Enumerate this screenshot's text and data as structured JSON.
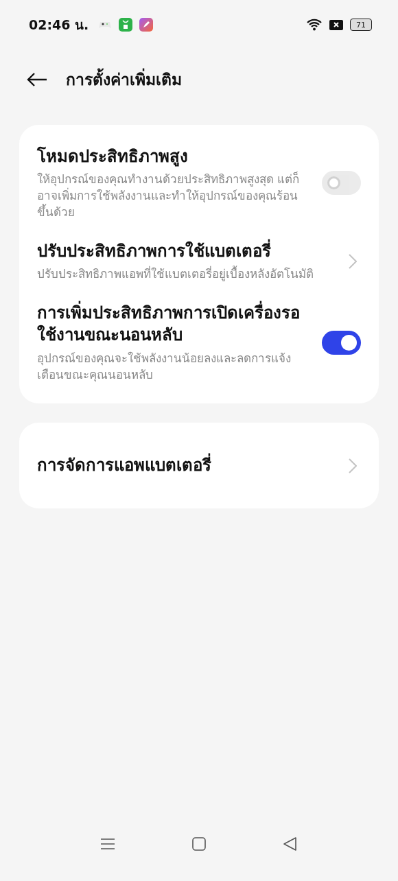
{
  "status_bar": {
    "time": "02:46 น.",
    "battery": "71"
  },
  "header": {
    "title": "การตั้งค่าเพิ่มเติม"
  },
  "groups": [
    {
      "items": [
        {
          "kind": "toggle",
          "title": "โหมดประสิทธิภาพสูง",
          "description": "ให้อุปกรณ์ของคุณทำงานด้วยประสิทธิภาพสูงสุด แต่ก็อาจเพิ่มการใช้พลังงานและทำให้อุปกรณ์ของคุณร้อนขึ้นด้วย",
          "on": false,
          "disabled": true
        },
        {
          "kind": "link",
          "title": "ปรับประสิทธิภาพการใช้แบตเตอรี่",
          "description": "ปรับประสิทธิภาพแอพที่ใช้แบตเตอรี่อยู่เบื้องหลังอัตโนมัติ"
        },
        {
          "kind": "toggle",
          "title": "การเพิ่มประสิทธิภาพการเปิดเครื่องรอใช้งานขณะนอนหลับ",
          "description": "อุปกรณ์ของคุณจะใช้พลังงานน้อยลงและลดการแจ้งเตือนขณะคุณนอนหลับ",
          "on": true,
          "disabled": false
        }
      ]
    },
    {
      "items": [
        {
          "kind": "link",
          "title": "การจัดการแอพแบตเตอรี่"
        }
      ]
    }
  ]
}
